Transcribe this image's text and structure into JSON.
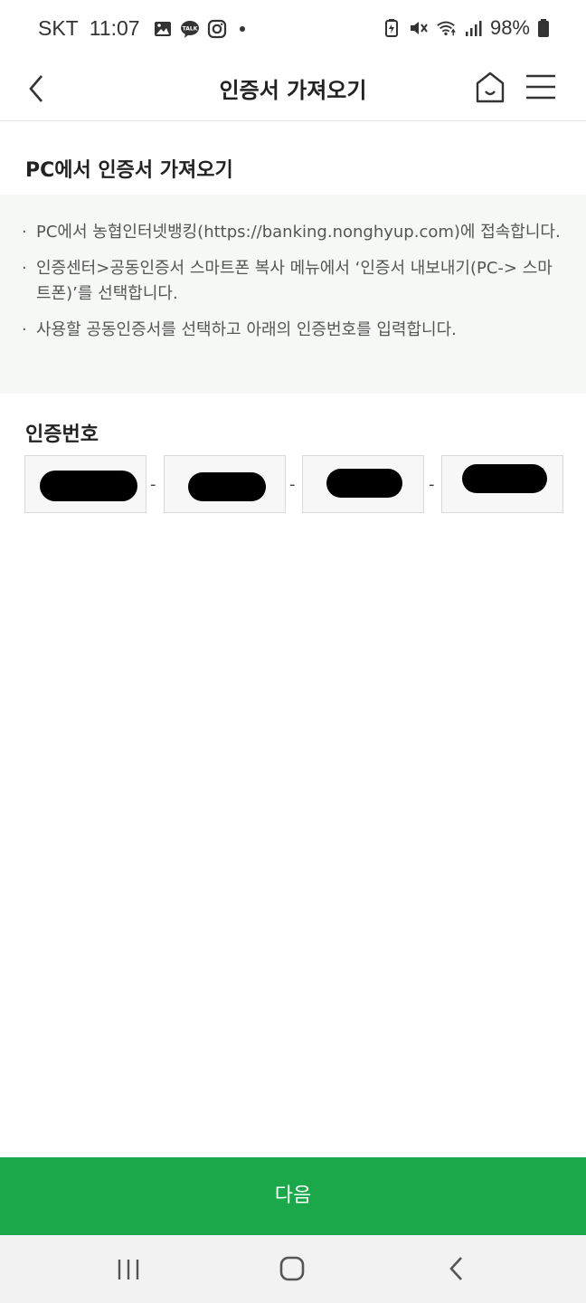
{
  "status_bar": {
    "carrier": "SKT",
    "time": "11:07",
    "battery": "98%",
    "icons": [
      "gallery-icon",
      "kakaotalk-icon",
      "instagram-icon",
      "notification-dot",
      "battery-saver-icon",
      "mute-icon",
      "wifi-icon",
      "signal-icon",
      "battery-icon"
    ]
  },
  "header": {
    "title": "인증서 가져오기",
    "back_icon": "chevron-left-icon",
    "home_icon": "home-icon",
    "menu_icon": "hamburger-menu-icon"
  },
  "main": {
    "section_title": "PC에서 인증서 가져오기",
    "guide": [
      "PC에서 농협인터넷뱅킹(https://banking.nonghyup.com)에 접속합니다.",
      "인증센터>공동인증서 스마트폰 복사 메뉴에서 ‘인증서 내보내기(PC-> 스마트폰)’를 선택합니다.",
      "사용할 공동인증서를 선택하고 아래의 인증번호를 입력합니다."
    ],
    "code_label": "인증번호",
    "code_separator": "-"
  },
  "footer": {
    "next_label": "다음"
  },
  "colors": {
    "accent": "#1aa84a",
    "guide_bg": "#f5f8f5"
  }
}
